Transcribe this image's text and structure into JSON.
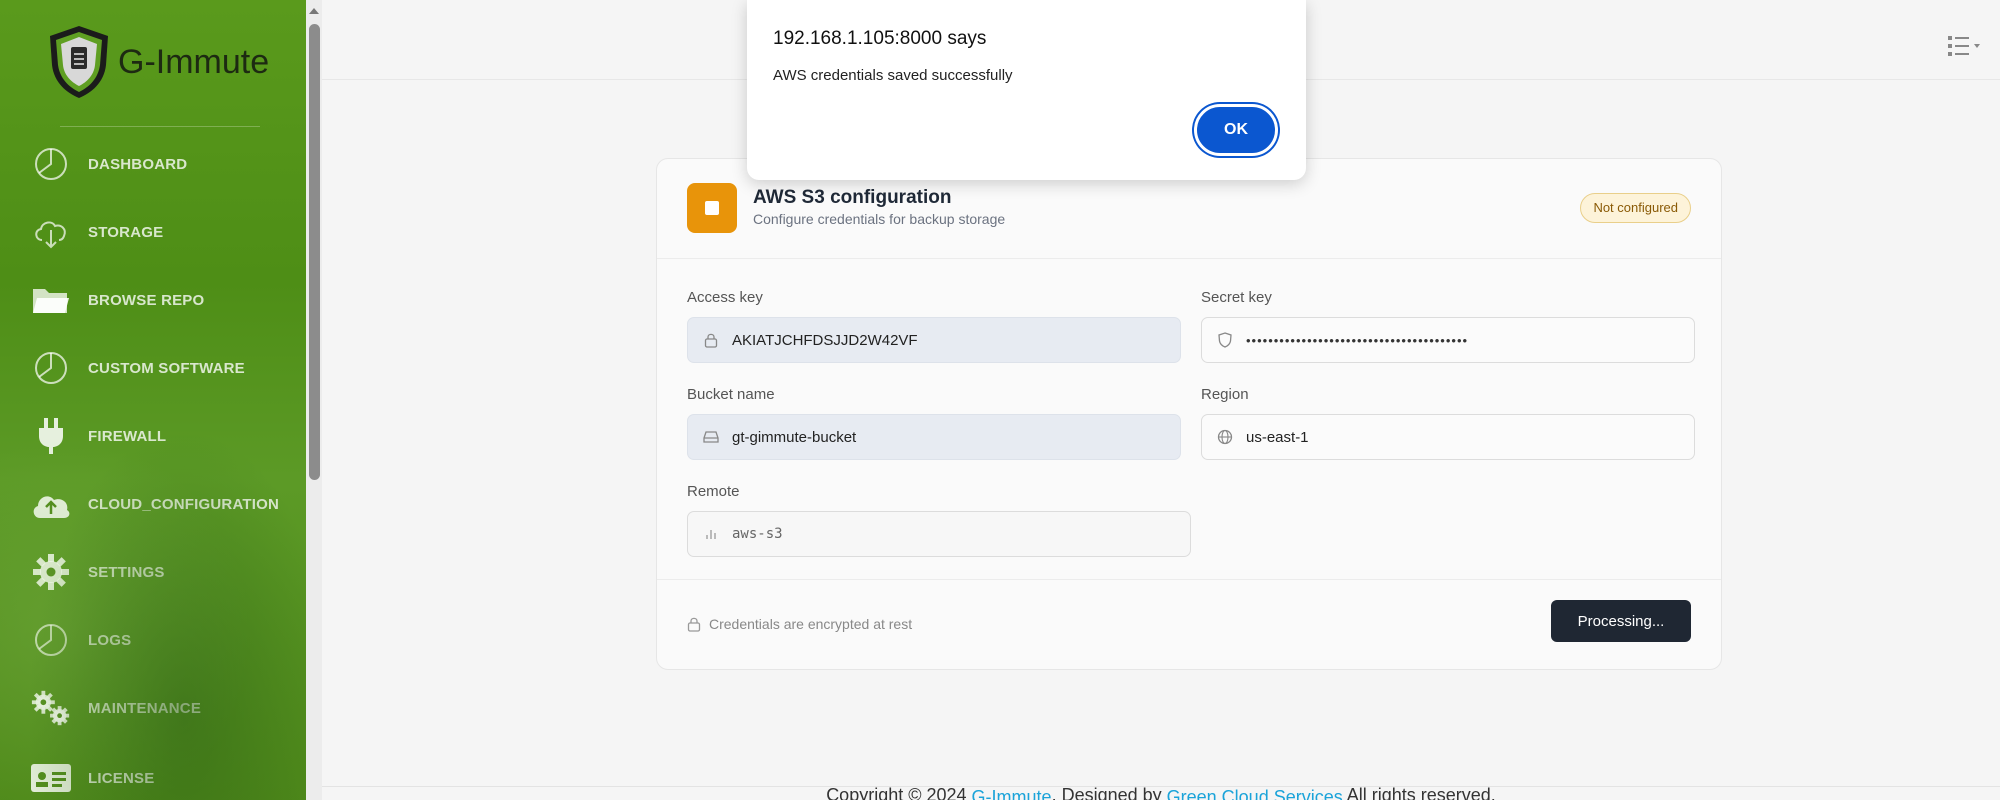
{
  "app": {
    "brand": "G-Immute"
  },
  "sidebar": {
    "items": [
      {
        "label": "DASHBOARD",
        "icon": "pie-chart-icon"
      },
      {
        "label": "STORAGE",
        "icon": "cloud-download-icon"
      },
      {
        "label": "BROWSE REPO",
        "icon": "folder-icon"
      },
      {
        "label": "CUSTOM SOFTWARE",
        "icon": "pie-chart-icon"
      },
      {
        "label": "FIREWALL",
        "icon": "plug-icon"
      },
      {
        "label": "CLOUD_CONFIGURATION",
        "icon": "cloud-upload-icon"
      },
      {
        "label": "SETTINGS",
        "icon": "gear-icon"
      },
      {
        "label": "LOGS",
        "icon": "pie-chart-icon"
      },
      {
        "label": "MAINTENANCE",
        "icon": "gears-icon"
      },
      {
        "label": "LICENSE",
        "icon": "id-card-icon"
      }
    ]
  },
  "card": {
    "title": "AWS S3 configuration",
    "subtitle": "Configure credentials for backup storage",
    "status_badge": "Not configured",
    "fields": {
      "access_key": {
        "label": "Access key",
        "value": "AKIATJCHFDSJJD2W42VF"
      },
      "secret_key": {
        "label": "Secret key",
        "value": "••••••••••••••••••••••••••••••••••••••••"
      },
      "bucket_name": {
        "label": "Bucket name",
        "value": "gt-gimmute-bucket"
      },
      "region": {
        "label": "Region",
        "value": "us-east-1"
      },
      "remote": {
        "label": "Remote",
        "value": "aws-s3"
      }
    },
    "footer_note": "Credentials are encrypted at rest",
    "action_button": "Processing..."
  },
  "footer": {
    "prefix": "Copyright © 2024 ",
    "brand_link": "G-Immute",
    "middle": ". Designed by ",
    "designer_link": "Green Cloud Services",
    "suffix": " All rights reserved."
  },
  "dialog": {
    "title": "192.168.1.105:8000 says",
    "message": "AWS credentials saved successfully",
    "ok_label": "OK"
  },
  "colors": {
    "sidebar_green": "#5a9a1c",
    "accent_blue": "#0b57d0",
    "badge_bg": "#fdf3d9",
    "icon_orange": "#e8940a",
    "dark_button": "#1f2733"
  }
}
